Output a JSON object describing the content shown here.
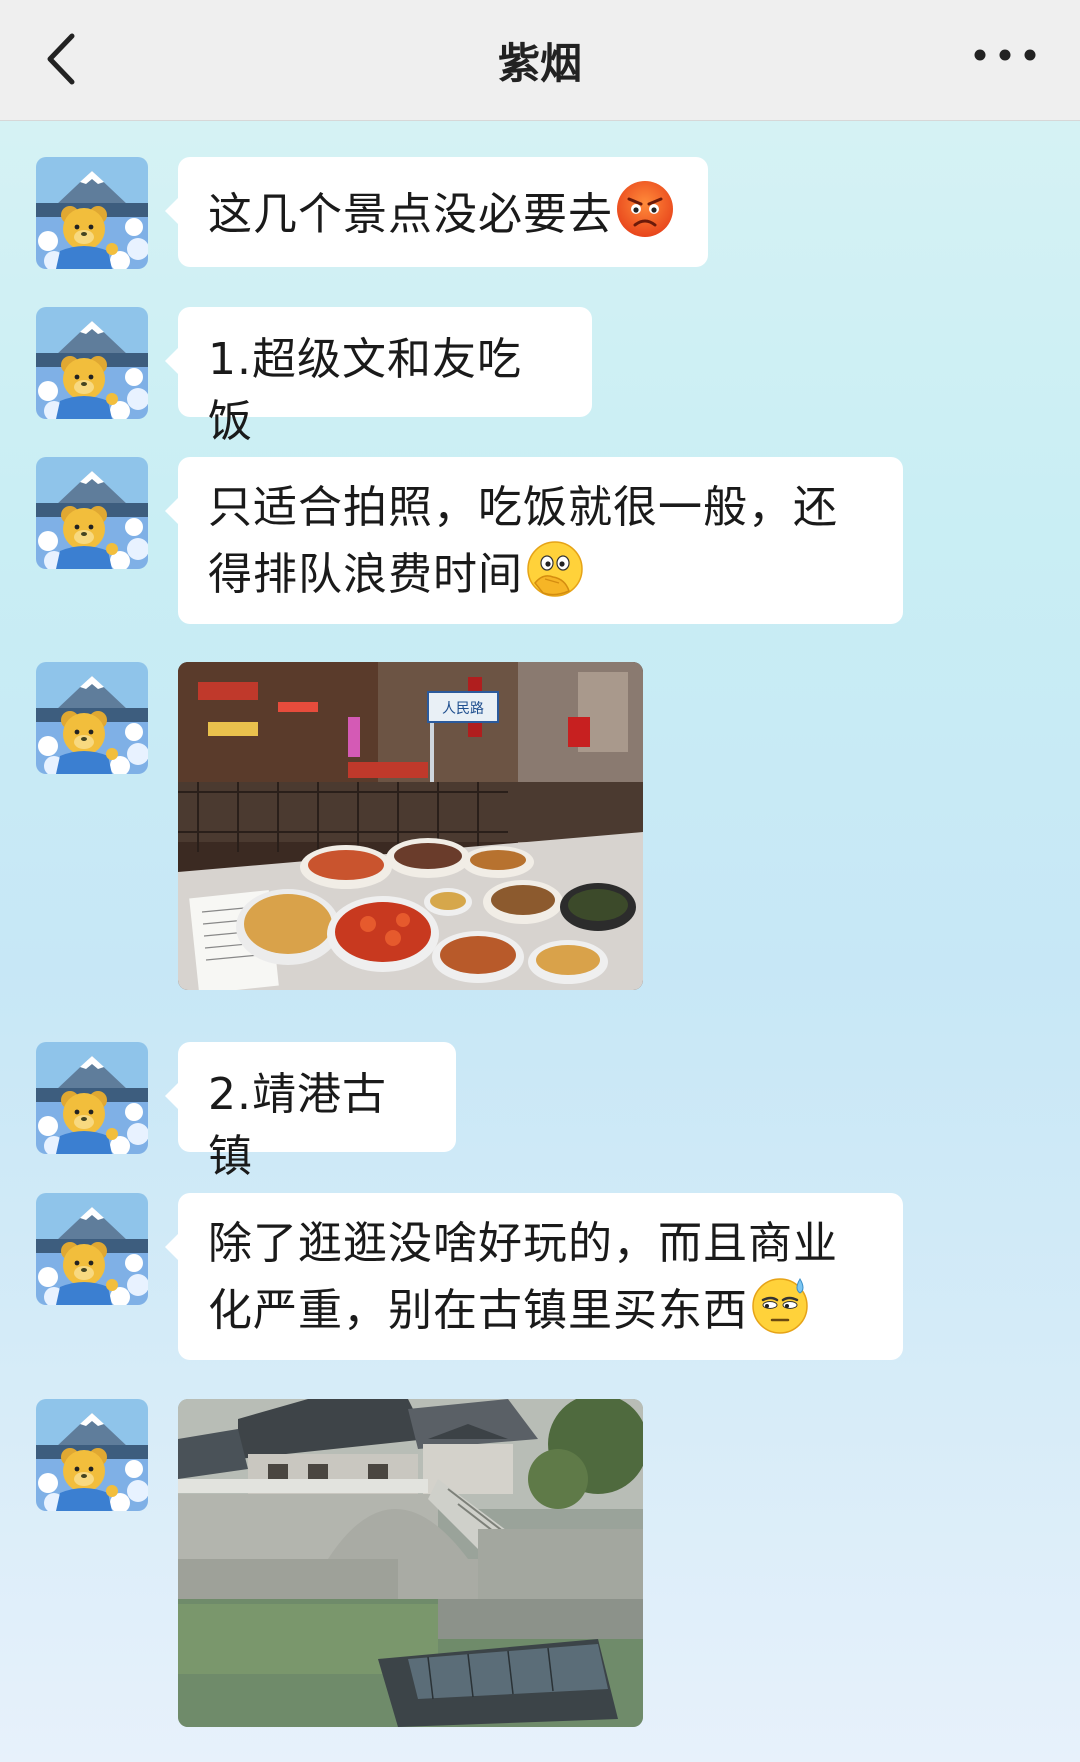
{
  "header": {
    "title": "紫烟"
  },
  "messages": [
    {
      "type": "text",
      "text": "这几个景点没必要去",
      "emoji": "angry-face"
    },
    {
      "type": "text",
      "text": "1.超级文和友吃饭"
    },
    {
      "type": "text",
      "lines": [
        "只适合拍照，吃饭就很一般，还",
        "得排队浪费时间"
      ],
      "emoji": "face-with-hand-over-mouth"
    },
    {
      "type": "image",
      "image": "restaurant-food-photo"
    },
    {
      "type": "text",
      "text": "2.靖港古镇"
    },
    {
      "type": "text",
      "lines": [
        "除了逛逛没啥好玩的，而且商业",
        "化严重，别在古镇里买东西"
      ],
      "emoji": "face-with-sweat"
    },
    {
      "type": "image",
      "image": "ancient-town-bridge-photo"
    }
  ],
  "colors": {
    "header_bg": "#efefef",
    "bubble_bg": "#ffffff",
    "chat_bg": "#c9eef4"
  },
  "icons": {
    "back": "chevron-left-icon",
    "more": "ellipsis-icon",
    "road_sign": "人民路"
  }
}
